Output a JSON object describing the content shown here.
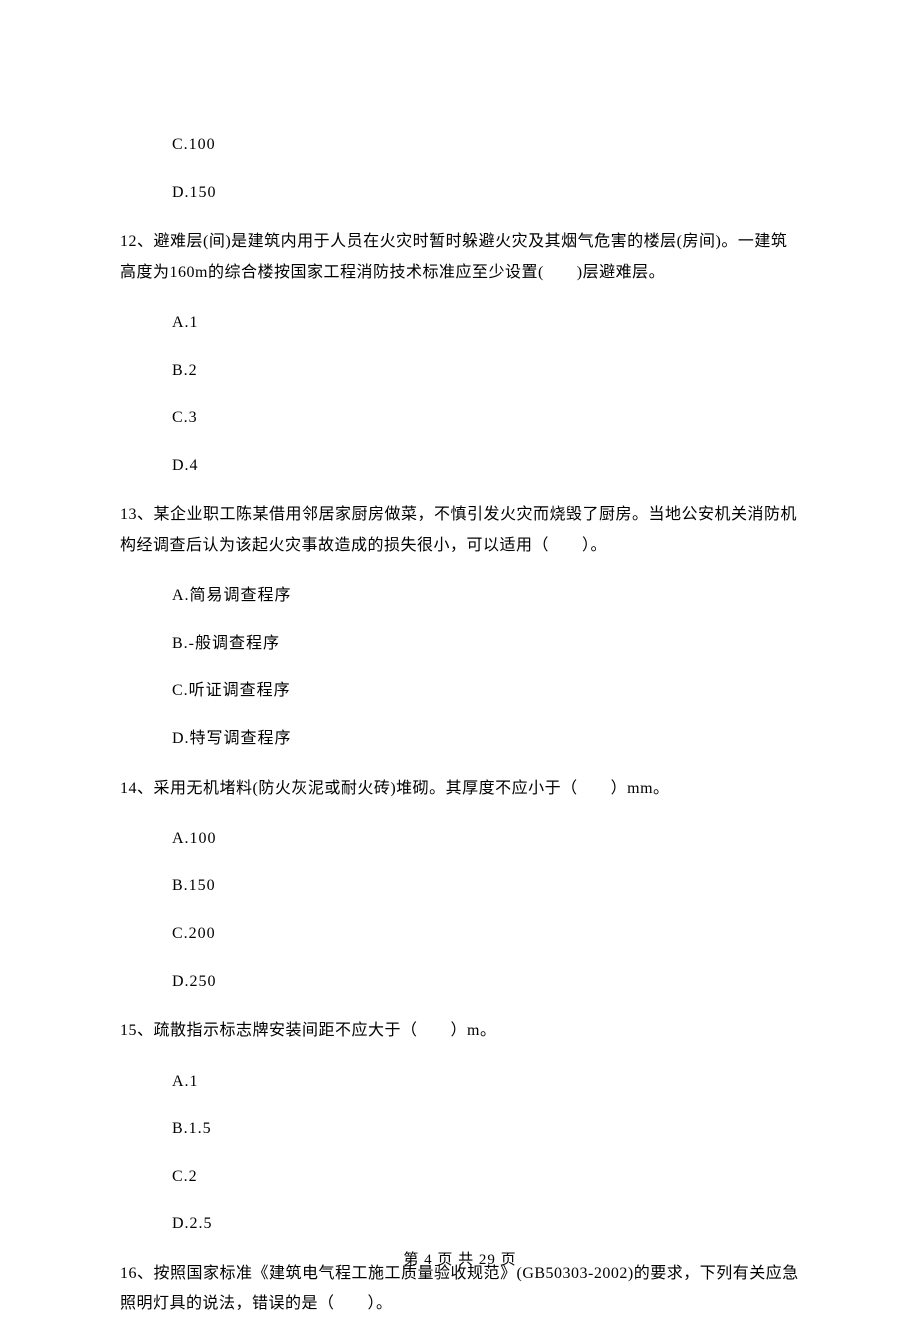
{
  "options_pre": [
    "C.100",
    "D.150"
  ],
  "questions": [
    {
      "text": "12、避难层(间)是建筑内用于人员在火灾时暂时躲避火灾及其烟气危害的楼层(房间)。一建筑高度为160m的综合楼按国家工程消防技术标准应至少设置(　　)层避难层。",
      "options": [
        "A.1",
        "B.2",
        "C.3",
        "D.4"
      ]
    },
    {
      "text": "13、某企业职工陈某借用邻居家厨房做菜，不慎引发火灾而烧毁了厨房。当地公安机关消防机构经调查后认为该起火灾事故造成的损失很小，可以适用（　　）。",
      "options": [
        "A.简易调查程序",
        "B.-般调查程序",
        "C.听证调查程序",
        "D.特写调查程序"
      ]
    },
    {
      "text": "14、采用无机堵料(防火灰泥或耐火砖)堆砌。其厚度不应小于（　　）mm。",
      "options": [
        "A.100",
        "B.150",
        "C.200",
        "D.250"
      ]
    },
    {
      "text": "15、疏散指示标志牌安装间距不应大于（　　）m。",
      "options": [
        "A.1",
        "B.1.5",
        "C.2",
        "D.2.5"
      ]
    },
    {
      "text": "16、按照国家标准《建筑电气程工施工质量验收规范》(GB50303-2002)的要求，下列有关应急照明灯具的说法，错误的是（　　）。",
      "options": []
    }
  ],
  "footer": "第 4 页 共 29 页"
}
